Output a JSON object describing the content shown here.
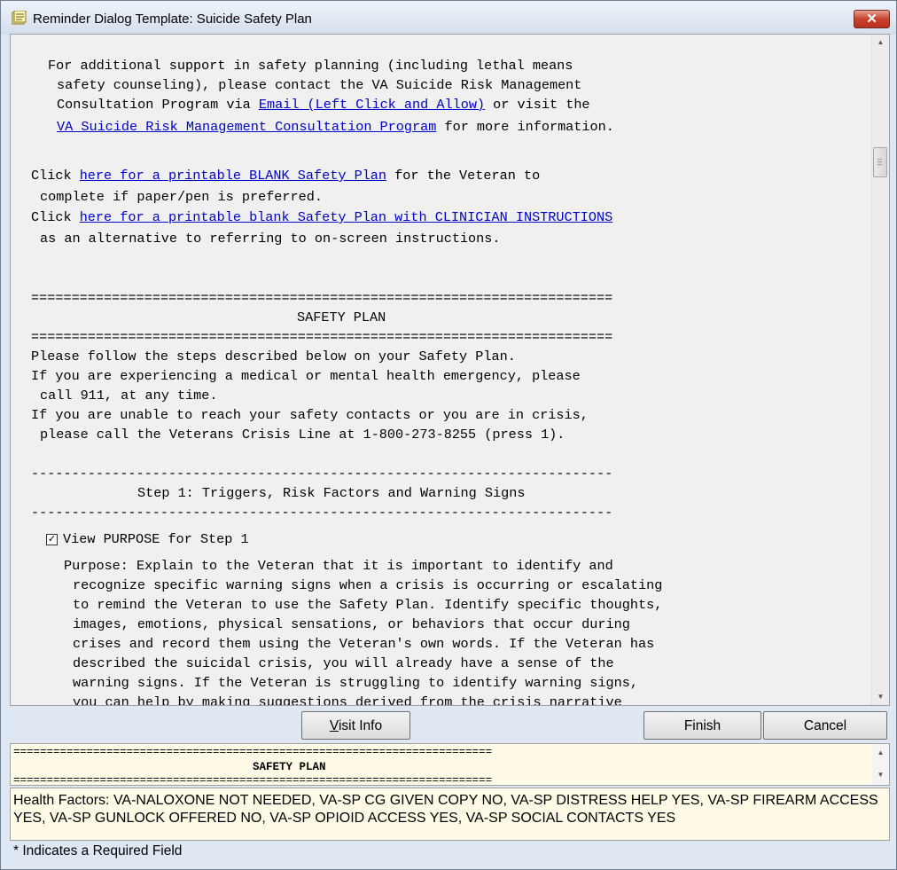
{
  "window": {
    "title": "Reminder Dialog Template: Suicide Safety Plan"
  },
  "content": {
    "intro_l1": "For additional support in safety planning (including lethal means",
    "intro_l2": "safety counseling), please contact the VA Suicide Risk Management",
    "intro_l3a": "Consultation Program via ",
    "intro_l3_link": "Email (Left Click and Allow)",
    "intro_l3b": " or visit the",
    "intro_l4_link": "VA Suicide Risk Management Consultation Program",
    "intro_l4b": " for more information.",
    "click1_a": "Click ",
    "click1_link": "here for a printable BLANK Safety Plan",
    "click1_b": " for the Veteran to",
    "click1_l2": "complete if paper/pen is preferred.",
    "click2_a": "Click ",
    "click2_link": "here for a printable blank Safety Plan with CLINICIAN INSTRUCTIONS",
    "click2_l2": "as an alternative to referring to on-screen instructions.",
    "double_rule": "========================================================================",
    "safety_plan_heading": "SAFETY PLAN",
    "follow_l1": "Please follow the steps described below on your Safety Plan.",
    "follow_l2": "If you are experiencing a medical or mental health emergency, please",
    "follow_l3": "call 911, at any time.",
    "follow_l4": "If you are unable to reach your safety contacts or you are in crisis,",
    "follow_l5": "please call the Veterans Crisis Line at 1-800-273-8255 (press 1).",
    "single_rule": "------------------------------------------------------------------------",
    "step1_heading": "Step 1: Triggers, Risk Factors and Warning Signs",
    "view_purpose_label": "View PURPOSE for Step 1",
    "view_purpose_checked": "✓",
    "purpose_lines": [
      "Purpose: Explain to the Veteran that it is important to identify and",
      "recognize specific warning signs when a crisis is occurring or escalating",
      "to remind the Veteran to use the Safety Plan. Identify specific thoughts,",
      "images, emotions, physical sensations, or behaviors that occur during",
      "crises and record them using the Veteran's own words. If the Veteran has",
      "described the suicidal crisis, you will already have a sense of the",
      "warning signs. If the Veteran is struggling to identify warning signs,",
      "you can help by making suggestions derived from the crisis narrative"
    ]
  },
  "buttons": {
    "visit_info": "Visit Info",
    "visit_info_mnemonic": "V",
    "visit_info_rest": "isit Info",
    "finish": "Finish",
    "cancel": "Cancel"
  },
  "preview": {
    "rule": "========================================================================",
    "heading": "SAFETY PLAN"
  },
  "health_factors": {
    "label": "Health Factors: ",
    "value": "VA-NALOXONE NOT NEEDED, VA-SP CG GIVEN COPY NO, VA-SP DISTRESS HELP YES, VA-SP FIREARM ACCESS YES, VA-SP GUNLOCK OFFERED NO, VA-SP OPIOID ACCESS YES, VA-SP SOCIAL CONTACTS YES"
  },
  "status": {
    "required_note": "* Indicates a Required Field"
  },
  "icons": {
    "title": "notepad-icon",
    "close": "close-icon",
    "scroll_up": "scroll-up-arrow-icon",
    "scroll_down": "scroll-down-arrow-icon"
  }
}
